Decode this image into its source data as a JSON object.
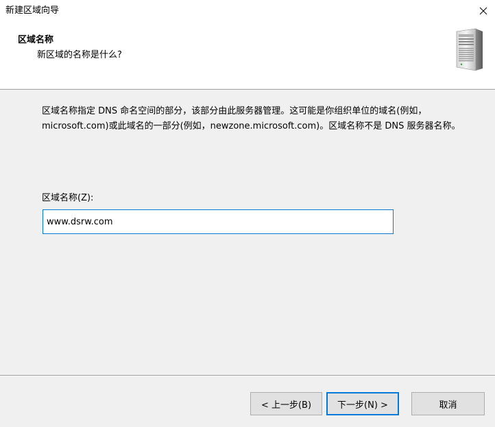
{
  "window": {
    "title": "新建区域向导",
    "close_label": "×"
  },
  "header": {
    "title": "区域名称",
    "subtitle": "新区域的名称是什么?",
    "icon": "server-icon"
  },
  "body": {
    "description": "区域名称指定 DNS 命名空间的部分，该部分由此服务器管理。这可能是你组织单位的域名(例如，microsoft.com)或此域名的一部分(例如，newzone.microsoft.com)。区域名称不是 DNS 服务器名称。",
    "zone_name_label": "区域名称(Z):",
    "zone_name_value": "www.dsrw.com"
  },
  "buttons": {
    "back": "< 上一步(B)",
    "next": "下一步(N) >",
    "cancel": "取消"
  },
  "colors": {
    "focus_accent": "#0078d7",
    "dialog_background": "#f0f0f0",
    "header_background": "#ffffff"
  }
}
